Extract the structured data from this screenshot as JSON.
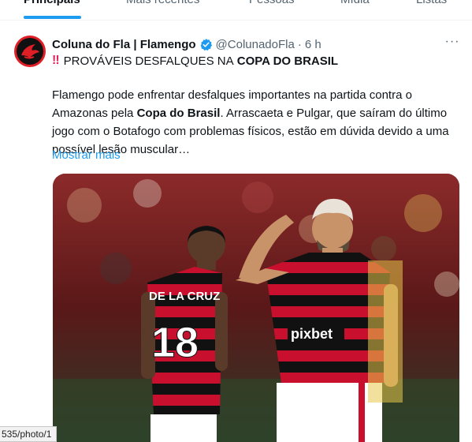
{
  "tabs": [
    {
      "label": "Principais",
      "active": true
    },
    {
      "label": "Mais recentes",
      "active": false
    },
    {
      "label": "Pessoas",
      "active": false
    },
    {
      "label": "Mídia",
      "active": false
    },
    {
      "label": "Listas",
      "active": false
    }
  ],
  "tweet": {
    "display_name": "Coluna do Fla | Flamengo",
    "handle": "@ColunadoFla",
    "separator": "·",
    "time": "6 h",
    "more_label": "···",
    "headline_prefix": "PROVÁVEIS DESFALQUES NA",
    "headline_bold": "COPA DO BRASIL",
    "body_part1": "Flamengo pode enfrentar desfalques importantes na partida contra o Amazonas pela",
    "body_bold": "Copa do Brasil",
    "body_part2": ". Arrascaeta e Pulgar, que saíram do último jogo com o Botafogo com problemas físicos, estão em dúvida devido a uma possível lesão muscular…",
    "show_more": "Mostrar mais",
    "media": {
      "jersey_sponsor": "pixbet",
      "jersey_name": "DE LA CRUZ",
      "jersey_number": "18"
    }
  },
  "status_url": "535/photo/1",
  "colors": {
    "accent": "#1d9bf0",
    "flamengo_red": "#c8102e",
    "alert": "#e0245e"
  }
}
